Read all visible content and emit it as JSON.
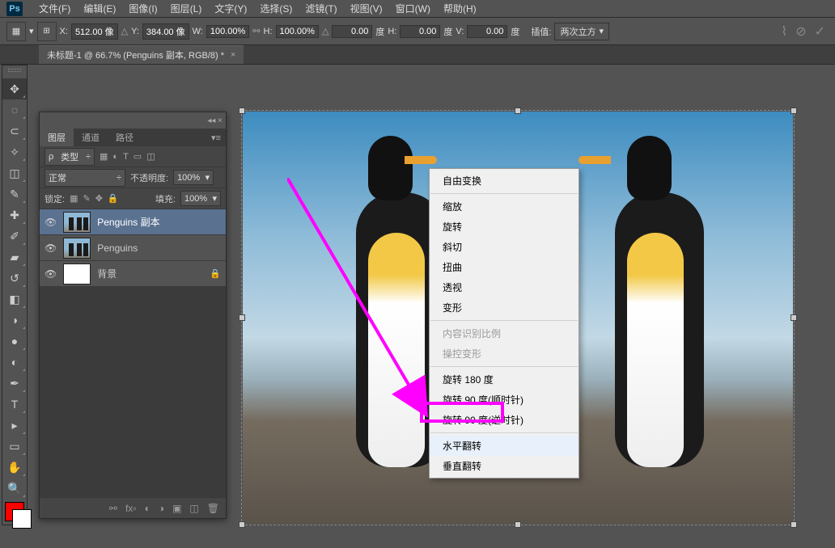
{
  "menu": [
    "文件(F)",
    "编辑(E)",
    "图像(I)",
    "图层(L)",
    "文字(Y)",
    "选择(S)",
    "滤镜(T)",
    "视图(V)",
    "窗口(W)",
    "帮助(H)"
  ],
  "options": {
    "x_label": "X:",
    "x": "512.00 像",
    "y_label": "Y:",
    "y": "384.00 像",
    "w_label": "W:",
    "w": "100.00%",
    "h_label": "H:",
    "h": "100.00%",
    "angle": "0.00",
    "angle_unit": "度",
    "h2_label": "H:",
    "h2": "0.00",
    "h2_unit": "度",
    "v_label": "V:",
    "v": "0.00",
    "v_unit": "度",
    "interp_label": "插值:",
    "interp": "两次立方"
  },
  "doc_tab": {
    "title": "未标题-1 @ 66.7% (Penguins 副本, RGB/8) *"
  },
  "layers": {
    "tabs": [
      "图层",
      "通道",
      "路径"
    ],
    "kind_label": "类型",
    "blend": "正常",
    "opacity_label": "不透明度:",
    "opacity": "100%",
    "lock_label": "锁定:",
    "fill_label": "填充:",
    "fill": "100%",
    "items": [
      {
        "name": "Penguins 副本",
        "selected": true
      },
      {
        "name": "Penguins",
        "selected": false
      },
      {
        "name": "背景",
        "selected": false,
        "locked": true
      }
    ]
  },
  "context_menu": [
    {
      "label": "自由变换",
      "type": "item"
    },
    {
      "type": "sep"
    },
    {
      "label": "缩放",
      "type": "item"
    },
    {
      "label": "旋转",
      "type": "item"
    },
    {
      "label": "斜切",
      "type": "item"
    },
    {
      "label": "扭曲",
      "type": "item"
    },
    {
      "label": "透视",
      "type": "item"
    },
    {
      "label": "变形",
      "type": "item"
    },
    {
      "type": "sep"
    },
    {
      "label": "内容识别比例",
      "type": "disabled"
    },
    {
      "label": "操控变形",
      "type": "disabled"
    },
    {
      "type": "sep"
    },
    {
      "label": "旋转 180 度",
      "type": "item"
    },
    {
      "label": "旋转 90 度(顺时针)",
      "type": "item"
    },
    {
      "label": "旋转 90 度(逆时针)",
      "type": "item"
    },
    {
      "type": "sep"
    },
    {
      "label": "水平翻转",
      "type": "item",
      "highlighted": true
    },
    {
      "label": "垂直翻转",
      "type": "item"
    }
  ],
  "ps": "Ps"
}
